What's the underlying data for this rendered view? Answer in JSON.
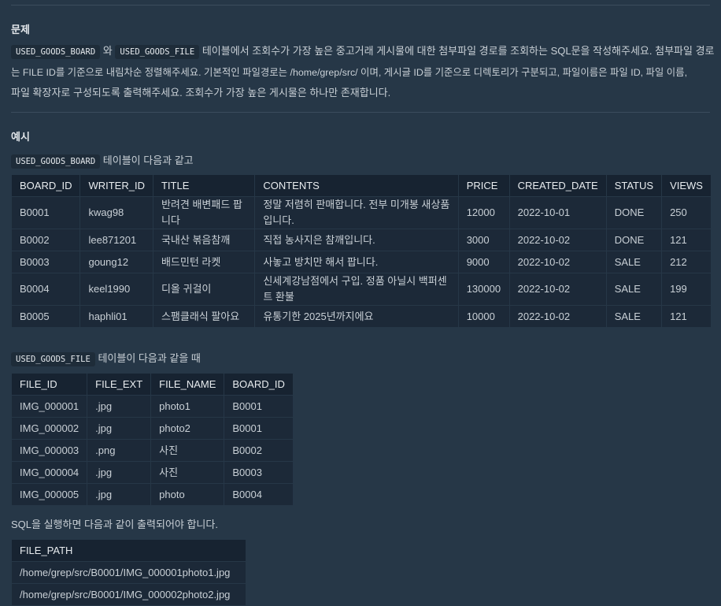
{
  "problem": {
    "heading": "문제",
    "code1": "USED_GOODS_BOARD",
    "word_and": "와",
    "code2": "USED_GOODS_FILE",
    "text_line1": "테이블에서 조회수가 가장 높은 중고거래 게시물에 대한 첨부파일 경로를 조회하는 SQL문을 작성해주세요. 첨부파일 경로",
    "text_line2": "는 FILE ID를 기준으로 내림차순 정렬해주세요. 기본적인 파일경로는 /home/grep/src/ 이며, 게시글 ID를 기준으로 디렉토리가 구분되고, 파일이름은 파일 ID, 파일 이름,",
    "text_line3": "파일 확장자로 구성되도록 출력해주세요. 조회수가 가장 높은 게시물은 하나만 존재합니다."
  },
  "example": {
    "heading": "예시",
    "board_intro_code": "USED_GOODS_BOARD",
    "board_intro_text": "테이블이 다음과 같고",
    "file_intro_code": "USED_GOODS_FILE",
    "file_intro_text": "테이블이 다음과 같을 때",
    "result_intro": "SQL을 실행하면 다음과 같이 출력되어야 합니다."
  },
  "board_table": {
    "headers": [
      "BOARD_ID",
      "WRITER_ID",
      "TITLE",
      "CONTENTS",
      "PRICE",
      "CREATED_DATE",
      "STATUS",
      "VIEWS"
    ],
    "rows": [
      [
        "B0001",
        "kwag98",
        "반려견 배변패드 팝니다",
        "정말 저렴히 판매합니다. 전부 미개봉 새상품입니다.",
        "12000",
        "2022-10-01",
        "DONE",
        "250"
      ],
      [
        "B0002",
        "lee871201",
        "국내산 볶음참깨",
        "직접 농사지은 참깨입니다.",
        "3000",
        "2022-10-02",
        "DONE",
        "121"
      ],
      [
        "B0003",
        "goung12",
        "배드민턴 라켓",
        "사놓고 방치만 해서 팝니다.",
        "9000",
        "2022-10-02",
        "SALE",
        "212"
      ],
      [
        "B0004",
        "keel1990",
        "디올 귀걸이",
        "신세계강남점에서 구입. 정품 아닐시 백퍼센트 환불",
        "130000",
        "2022-10-02",
        "SALE",
        "199"
      ],
      [
        "B0005",
        "haphli01",
        "스팸클래식 팔아요",
        "유통기한 2025년까지에요",
        "10000",
        "2022-10-02",
        "SALE",
        "121"
      ]
    ]
  },
  "file_table": {
    "headers": [
      "FILE_ID",
      "FILE_EXT",
      "FILE_NAME",
      "BOARD_ID"
    ],
    "rows": [
      [
        "IMG_000001",
        ".jpg",
        "photo1",
        "B0001"
      ],
      [
        "IMG_000002",
        ".jpg",
        "photo2",
        "B0001"
      ],
      [
        "IMG_000003",
        ".png",
        "사진",
        "B0002"
      ],
      [
        "IMG_000004",
        ".jpg",
        "사진",
        "B0003"
      ],
      [
        "IMG_000005",
        ".jpg",
        "photo",
        "B0004"
      ]
    ]
  },
  "result_table": {
    "headers": [
      "FILE_PATH"
    ],
    "rows": [
      [
        "/home/grep/src/B0001/IMG_000001photo1.jpg"
      ],
      [
        "/home/grep/src/B0001/IMG_000002photo2.jpg"
      ]
    ]
  }
}
